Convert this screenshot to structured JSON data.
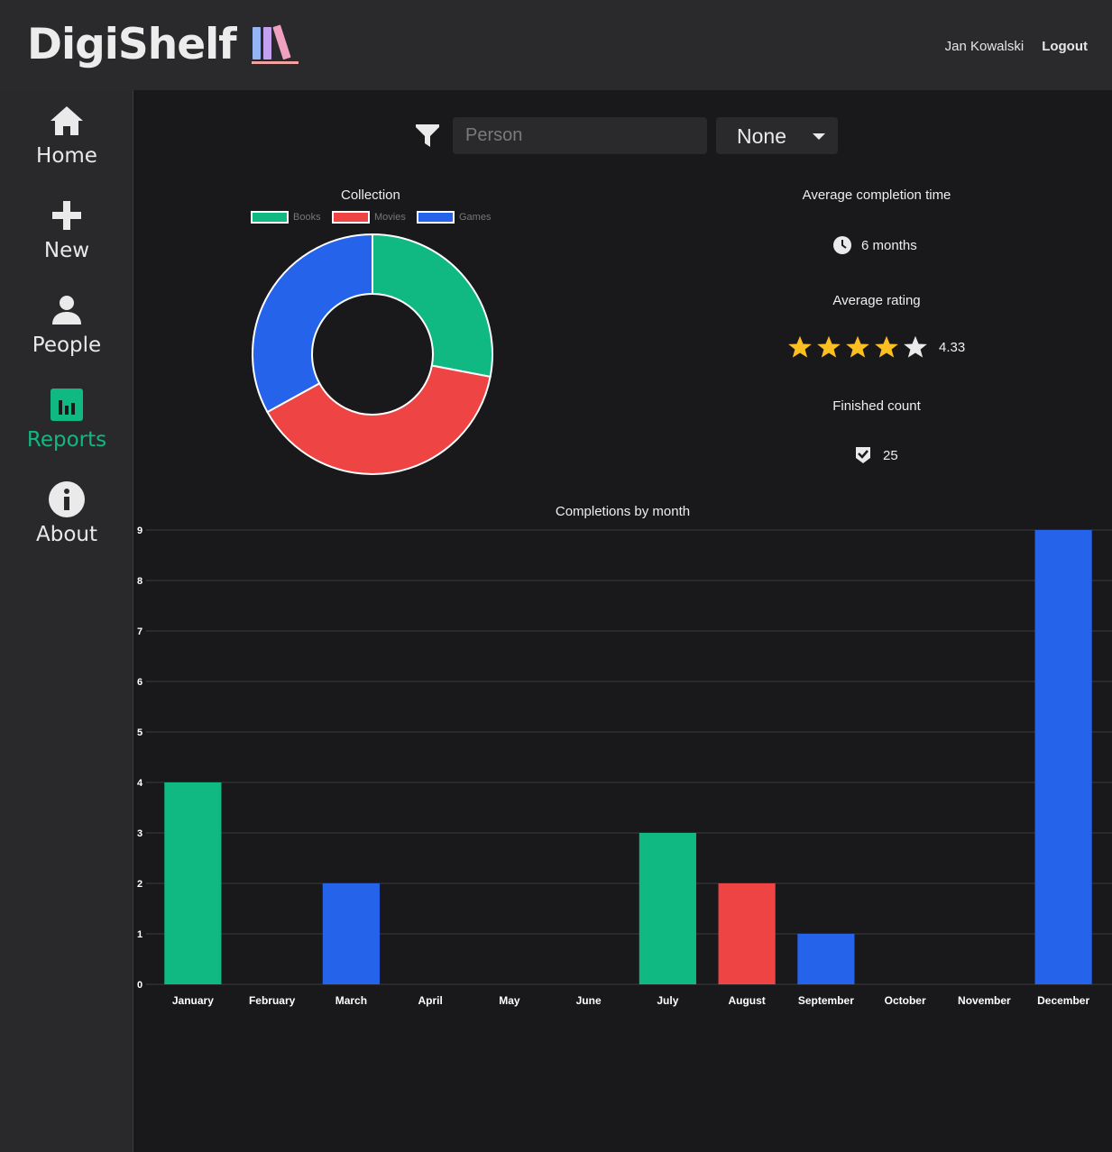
{
  "app": {
    "title": "DigiShelf",
    "user_name": "Jan Kowalski",
    "logout_label": "Logout"
  },
  "nav": {
    "items": [
      {
        "label": "Home",
        "icon": "home-icon"
      },
      {
        "label": "New",
        "icon": "plus-icon"
      },
      {
        "label": "People",
        "icon": "person-icon"
      },
      {
        "label": "Reports",
        "icon": "bar-chart-icon",
        "active": true
      },
      {
        "label": "About",
        "icon": "info-icon"
      }
    ],
    "active_color": "#10b981"
  },
  "filter": {
    "person_placeholder": "Person",
    "person_value": "",
    "type_select_value": "None"
  },
  "stats": {
    "avg_completion_title": "Average completion time",
    "avg_completion_value": "6 months",
    "avg_rating_title": "Average rating",
    "avg_rating_value": "4.33",
    "avg_rating_stars": 4.33,
    "finished_title": "Finished count",
    "finished_value": "25"
  },
  "colors": {
    "books": "#10b981",
    "movies": "#ef4444",
    "games": "#2563eb",
    "star": "#fbbf24"
  },
  "chart_data": [
    {
      "type": "pie",
      "title": "Collection",
      "categories": [
        "Books",
        "Movies",
        "Games"
      ],
      "values": [
        28,
        39,
        33
      ],
      "colors": [
        "#10b981",
        "#ef4444",
        "#2563eb"
      ],
      "legend": "top"
    },
    {
      "type": "bar",
      "title": "Completions by month",
      "categories": [
        "January",
        "February",
        "March",
        "April",
        "May",
        "June",
        "July",
        "August",
        "September",
        "October",
        "November",
        "December"
      ],
      "values": [
        4,
        0,
        2,
        0,
        0,
        0,
        3,
        2,
        1,
        0,
        0,
        9
      ],
      "bar_colors": [
        "#10b981",
        "#10b981",
        "#2563eb",
        "#2563eb",
        "#2563eb",
        "#2563eb",
        "#10b981",
        "#ef4444",
        "#2563eb",
        "#2563eb",
        "#2563eb",
        "#2563eb"
      ],
      "ylim": [
        0,
        9
      ],
      "yticks": [
        0,
        1,
        2,
        3,
        4,
        5,
        6,
        7,
        8,
        9
      ],
      "grid": true
    }
  ]
}
